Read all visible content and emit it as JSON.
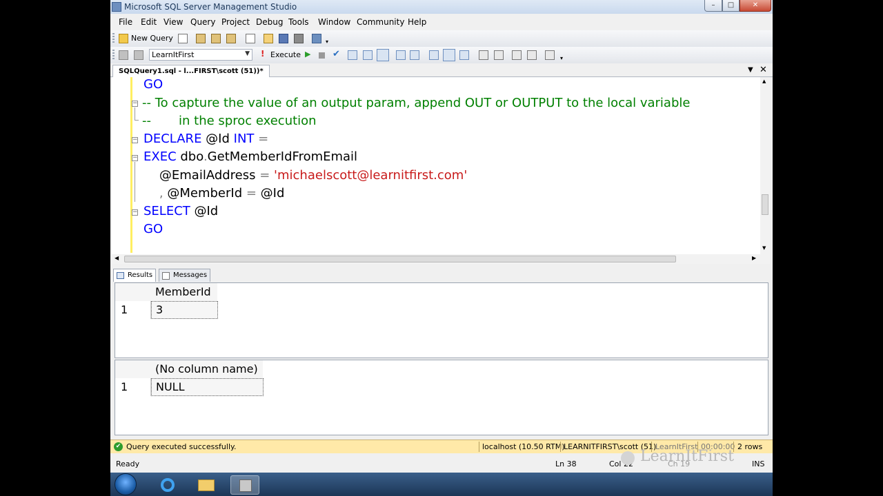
{
  "window": {
    "title": "Microsoft SQL Server Management Studio",
    "minimize": "0",
    "maximize": "1",
    "close": "r"
  },
  "menu": [
    "File",
    "Edit",
    "View",
    "Query",
    "Project",
    "Debug",
    "Tools",
    "Window",
    "Community",
    "Help"
  ],
  "toolbar": {
    "new_query_label": "New Query",
    "database": "LearnItFirst",
    "execute_label": "Execute"
  },
  "document_tab": {
    "label": "SQLQuery1.sql - l...FIRST\\scott (51))*",
    "close": "✕",
    "dropdown": "▼"
  },
  "editor": {
    "lines": [
      {
        "parts": [
          {
            "cls": "kw",
            "text": "GO"
          }
        ]
      },
      {
        "parts": [
          {
            "cls": "cm",
            "text": "-- To capture the value of an output param, append OUT or OUTPUT to the local variable"
          }
        ]
      },
      {
        "parts": [
          {
            "cls": "cm",
            "text": "--       in the sproc execution"
          }
        ]
      },
      {
        "parts": [
          {
            "cls": "kw",
            "text": "DECLARE "
          },
          {
            "cls": "tx",
            "text": "@Id "
          },
          {
            "cls": "kw",
            "text": "INT "
          },
          {
            "cls": "gr",
            "text": "="
          }
        ]
      },
      {
        "parts": [
          {
            "cls": "kw",
            "text": "EXEC "
          },
          {
            "cls": "tx",
            "text": "dbo"
          },
          {
            "cls": "gr",
            "text": "."
          },
          {
            "cls": "tx",
            "text": "GetMemberIdFromEmail"
          }
        ]
      },
      {
        "parts": [
          {
            "cls": "tx",
            "text": "    @EmailAddress "
          },
          {
            "cls": "gr",
            "text": "= "
          },
          {
            "cls": "st",
            "text": "'michaelscott@learnitfirst.com'"
          }
        ]
      },
      {
        "parts": [
          {
            "cls": "gr",
            "text": "    , "
          },
          {
            "cls": "tx",
            "text": "@MemberId "
          },
          {
            "cls": "gr",
            "text": "= "
          },
          {
            "cls": "tx",
            "text": "@Id"
          }
        ]
      },
      {
        "parts": [
          {
            "cls": "kw",
            "text": "SELECT "
          },
          {
            "cls": "tx",
            "text": "@Id"
          }
        ]
      },
      {
        "parts": [
          {
            "cls": "kw",
            "text": "GO"
          }
        ]
      }
    ]
  },
  "results_tabs": {
    "results": "Results",
    "messages": "Messages"
  },
  "grid1": {
    "header": "MemberId",
    "row_num": "1",
    "value": "3"
  },
  "grid2": {
    "header": "(No column name)",
    "row_num": "1",
    "value": "NULL"
  },
  "query_status": {
    "message": "Query executed successfully.",
    "server": "localhost (10.50 RTM)",
    "login": "LEARNITFIRST\\scott (51)",
    "database": "LearnItFirst",
    "elapsed": "00:00:00",
    "rows": "2 rows"
  },
  "statusbar": {
    "ready": "Ready",
    "ln": "Ln 38",
    "col": "Col 22",
    "ch": "Ch 19",
    "ins": "INS"
  },
  "watermark": "LearnItFirst"
}
